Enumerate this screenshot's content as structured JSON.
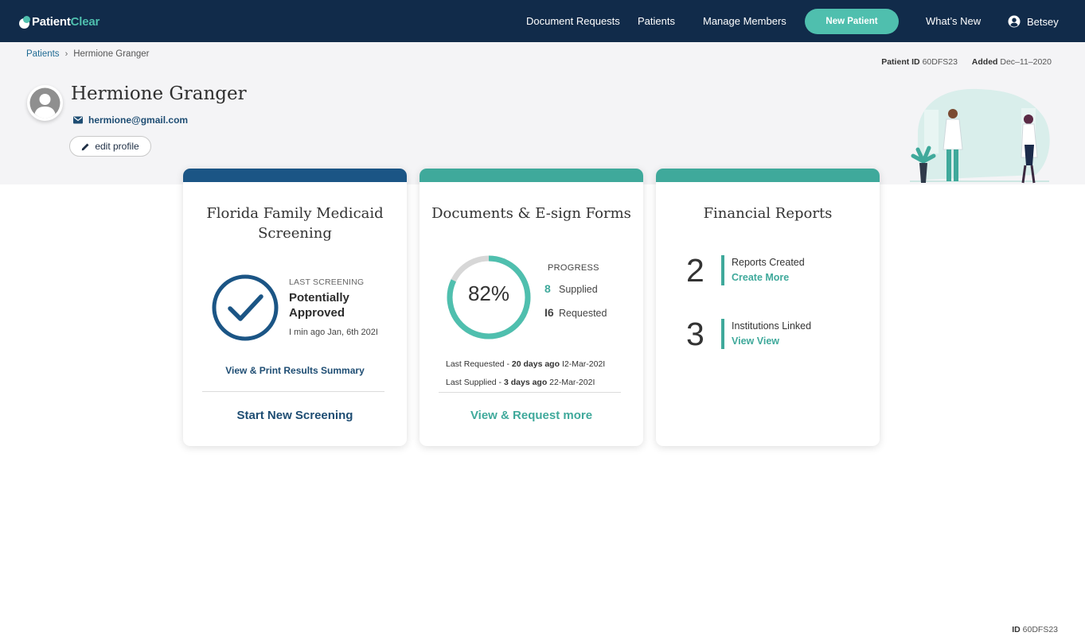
{
  "nav": {
    "brand_part1": "Patient",
    "brand_part2": "Clear",
    "links": [
      "Document Requests",
      "Patients",
      "Manage Members"
    ],
    "new_patient": "New Patient",
    "whats_new": "What’s New",
    "user": "Betsey"
  },
  "breadcrumb": {
    "parent": "Patients",
    "current": "Hermione Granger"
  },
  "meta": {
    "patient_id_label": "Patient ID",
    "patient_id": "60DFS23",
    "added_label": "Added",
    "added": "Dec–11–2020"
  },
  "patient": {
    "name": "Hermione Granger",
    "email": "hermione@gmail.com",
    "edit_label": "edit profile"
  },
  "screening": {
    "title": "Florida Family Medicaid Screening",
    "last_label": "LAST SCREENING",
    "status": "Potentially Approved",
    "time": "I min ago Jan, 6th 202I",
    "view_link": "View  & Print Results Summary",
    "action": "Start New Screening"
  },
  "documents": {
    "title": "Documents & E-sign Forms",
    "percent_label": "82%",
    "percent": 82,
    "progress_label": "PROGRESS",
    "supplied_count": "8",
    "supplied_label": "Supplied",
    "requested_count": "I6",
    "requested_label": "Requested",
    "last_requested_label": "Last Requested - ",
    "last_requested_ago": "20 days ago",
    "last_requested_date": "I2-Mar-202I",
    "last_supplied_label": "Last Supplied - ",
    "last_supplied_ago": "3 days ago",
    "last_supplied_date": "22-Mar-202I",
    "action": "View & Request more"
  },
  "financial": {
    "title": "Financial Reports",
    "reports_count": "2",
    "reports_label": "Reports Created",
    "reports_link": "Create  More",
    "institutions_count": "3",
    "institutions_label": "Institutions Linked",
    "institutions_link": "View View"
  },
  "footer": {
    "id_label": "ID",
    "id": "60DFS23"
  },
  "colors": {
    "navy": "#112b4a",
    "teal": "#4fbfae",
    "card_teal": "#3fa99b",
    "blue_bar": "#1b5585",
    "link_blue": "#1e4d73"
  }
}
